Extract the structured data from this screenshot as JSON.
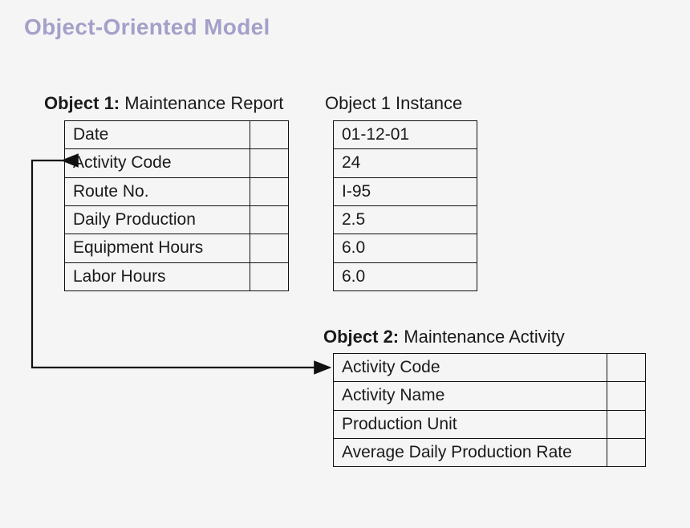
{
  "title": "Object-Oriented Model",
  "object1": {
    "label_prefix": "Object 1:",
    "label_name": "Maintenance Report",
    "fields": [
      "Date",
      "Activity Code",
      "Route No.",
      "Daily Production",
      "Equipment Hours",
      "Labor Hours"
    ]
  },
  "instance": {
    "label": "Object 1 Instance",
    "values": [
      "01-12-01",
      "24",
      "I-95",
      "2.5",
      "6.0",
      "6.0"
    ]
  },
  "object2": {
    "label_prefix": "Object 2:",
    "label_name": "Maintenance Activity",
    "fields": [
      "Activity Code",
      "Activity Name",
      "Production Unit",
      "Average Daily Production Rate"
    ]
  }
}
